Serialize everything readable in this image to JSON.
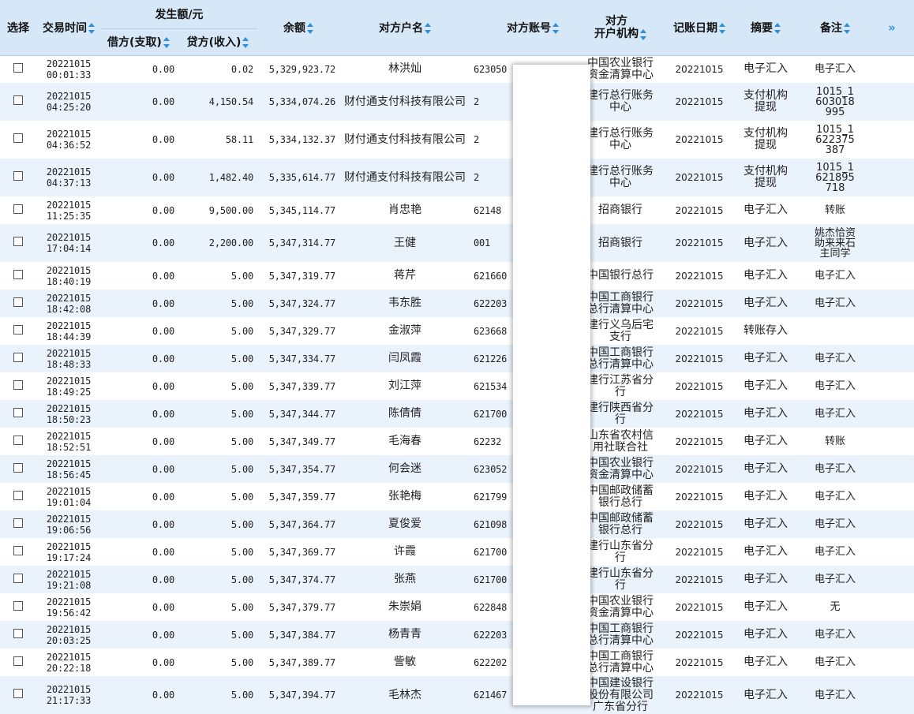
{
  "header": {
    "select": "选择",
    "time": "交易时间",
    "amount_group": "发生额/元",
    "debit": "借方(支取)",
    "credit": "贷方(收入)",
    "balance": "余额",
    "cp_name": "对方户名",
    "cp_account": "对方账号",
    "cp_bank": "对方\n开户机构",
    "post_date": "记账日期",
    "summary": "摘要",
    "note": "备注",
    "expand": "»"
  },
  "rows": [
    {
      "date": "20221015",
      "time": "00:01:33",
      "debit": "0.00",
      "credit": "0.02",
      "balance": "5,329,923.72",
      "name": "林洪灿",
      "acct": "623050",
      "bank": "中国农业银行资金清算中心",
      "post": "20221015",
      "summary": "电子汇入",
      "note": "电子汇入"
    },
    {
      "date": "20221015",
      "time": "04:25:20",
      "debit": "0.00",
      "credit": "4,150.54",
      "balance": "5,334,074.26",
      "name": "财付通支付科技有限公司",
      "acct": "2",
      "bank": "建行总行账务中心",
      "post": "20221015",
      "summary": "支付机构提现",
      "note": "1015_1603018995"
    },
    {
      "date": "20221015",
      "time": "04:36:52",
      "debit": "0.00",
      "credit": "58.11",
      "balance": "5,334,132.37",
      "name": "财付通支付科技有限公司",
      "acct": "2",
      "bank": "建行总行账务中心",
      "post": "20221015",
      "summary": "支付机构提现",
      "note": "1015_1622375387"
    },
    {
      "date": "20221015",
      "time": "04:37:13",
      "debit": "0.00",
      "credit": "1,482.40",
      "balance": "5,335,614.77",
      "name": "财付通支付科技有限公司",
      "acct": "2",
      "bank": "建行总行账务中心",
      "post": "20221015",
      "summary": "支付机构提现",
      "note": "1015_1621895718"
    },
    {
      "date": "20221015",
      "time": "11:25:35",
      "debit": "0.00",
      "credit": "9,500.00",
      "balance": "5,345,114.77",
      "name": "肖忠艳",
      "acct": "62148",
      "bank": "招商银行",
      "post": "20221015",
      "summary": "电子汇入",
      "note": "转账"
    },
    {
      "date": "20221015",
      "time": "17:04:14",
      "debit": "0.00",
      "credit": "2,200.00",
      "balance": "5,347,314.77",
      "name": "王健",
      "acct": "001",
      "bank": "招商银行",
      "post": "20221015",
      "summary": "电子汇入",
      "note": "姚杰恰资助来来石主同学"
    },
    {
      "date": "20221015",
      "time": "18:40:19",
      "debit": "0.00",
      "credit": "5.00",
      "balance": "5,347,319.77",
      "name": "蒋芹",
      "acct": "621660",
      "bank": "中国银行总行",
      "post": "20221015",
      "summary": "电子汇入",
      "note": "电子汇入"
    },
    {
      "date": "20221015",
      "time": "18:42:08",
      "debit": "0.00",
      "credit": "5.00",
      "balance": "5,347,324.77",
      "name": "韦东胜",
      "acct": "622203",
      "bank": "中国工商银行总行清算中心",
      "post": "20221015",
      "summary": "电子汇入",
      "note": "电子汇入"
    },
    {
      "date": "20221015",
      "time": "18:44:39",
      "debit": "0.00",
      "credit": "5.00",
      "balance": "5,347,329.77",
      "name": "金淑萍",
      "acct": "623668",
      "bank": "建行义乌后宅支行",
      "post": "20221015",
      "summary": "转账存入",
      "note": ""
    },
    {
      "date": "20221015",
      "time": "18:48:33",
      "debit": "0.00",
      "credit": "5.00",
      "balance": "5,347,334.77",
      "name": "闫凤霞",
      "acct": "621226",
      "bank": "中国工商银行总行清算中心",
      "post": "20221015",
      "summary": "电子汇入",
      "note": "电子汇入"
    },
    {
      "date": "20221015",
      "time": "18:49:25",
      "debit": "0.00",
      "credit": "5.00",
      "balance": "5,347,339.77",
      "name": "刘江萍",
      "acct": "621534",
      "bank": "建行江苏省分行",
      "post": "20221015",
      "summary": "电子汇入",
      "note": "电子汇入"
    },
    {
      "date": "20221015",
      "time": "18:50:23",
      "debit": "0.00",
      "credit": "5.00",
      "balance": "5,347,344.77",
      "name": "陈倩倩",
      "acct": "621700",
      "bank": "建行陕西省分行",
      "post": "20221015",
      "summary": "电子汇入",
      "note": "电子汇入"
    },
    {
      "date": "20221015",
      "time": "18:52:51",
      "debit": "0.00",
      "credit": "5.00",
      "balance": "5,347,349.77",
      "name": "毛海春",
      "acct": "62232",
      "bank": "山东省农村信用社联合社",
      "post": "20221015",
      "summary": "电子汇入",
      "note": "转账"
    },
    {
      "date": "20221015",
      "time": "18:56:45",
      "debit": "0.00",
      "credit": "5.00",
      "balance": "5,347,354.77",
      "name": "何会迷",
      "acct": "623052",
      "bank": "中国农业银行资金清算中心",
      "post": "20221015",
      "summary": "电子汇入",
      "note": "电子汇入"
    },
    {
      "date": "20221015",
      "time": "19:01:04",
      "debit": "0.00",
      "credit": "5.00",
      "balance": "5,347,359.77",
      "name": "张艳梅",
      "acct": "621799",
      "bank": "中国邮政储蓄银行总行",
      "post": "20221015",
      "summary": "电子汇入",
      "note": "电子汇入"
    },
    {
      "date": "20221015",
      "time": "19:06:56",
      "debit": "0.00",
      "credit": "5.00",
      "balance": "5,347,364.77",
      "name": "夏俊爱",
      "acct": "621098",
      "bank": "中国邮政储蓄银行总行",
      "post": "20221015",
      "summary": "电子汇入",
      "note": "电子汇入"
    },
    {
      "date": "20221015",
      "time": "19:17:24",
      "debit": "0.00",
      "credit": "5.00",
      "balance": "5,347,369.77",
      "name": "许霞",
      "acct": "621700",
      "bank": "建行山东省分行",
      "post": "20221015",
      "summary": "电子汇入",
      "note": "电子汇入"
    },
    {
      "date": "20221015",
      "time": "19:21:08",
      "debit": "0.00",
      "credit": "5.00",
      "balance": "5,347,374.77",
      "name": "张燕",
      "acct": "621700",
      "bank": "建行山东省分行",
      "post": "20221015",
      "summary": "电子汇入",
      "note": "电子汇入"
    },
    {
      "date": "20221015",
      "time": "19:56:42",
      "debit": "0.00",
      "credit": "5.00",
      "balance": "5,347,379.77",
      "name": "朱崇娟",
      "acct": "622848",
      "bank": "中国农业银行资金清算中心",
      "post": "20221015",
      "summary": "电子汇入",
      "note": "无"
    },
    {
      "date": "20221015",
      "time": "20:03:25",
      "debit": "0.00",
      "credit": "5.00",
      "balance": "5,347,384.77",
      "name": "杨青青",
      "acct": "622203",
      "bank": "中国工商银行总行清算中心",
      "post": "20221015",
      "summary": "电子汇入",
      "note": "电子汇入"
    },
    {
      "date": "20221015",
      "time": "20:22:18",
      "debit": "0.00",
      "credit": "5.00",
      "balance": "5,347,389.77",
      "name": "訾敏",
      "acct": "622202",
      "bank": "中国工商银行总行清算中心",
      "post": "20221015",
      "summary": "电子汇入",
      "note": "电子汇入"
    },
    {
      "date": "20221015",
      "time": "21:17:33",
      "debit": "0.00",
      "credit": "5.00",
      "balance": "5,347,394.77",
      "name": "毛林杰",
      "acct": "621467",
      "bank": "中国建设银行股份有限公司广东省分行",
      "post": "20221015",
      "summary": "电子汇入",
      "note": "电子汇入"
    }
  ]
}
